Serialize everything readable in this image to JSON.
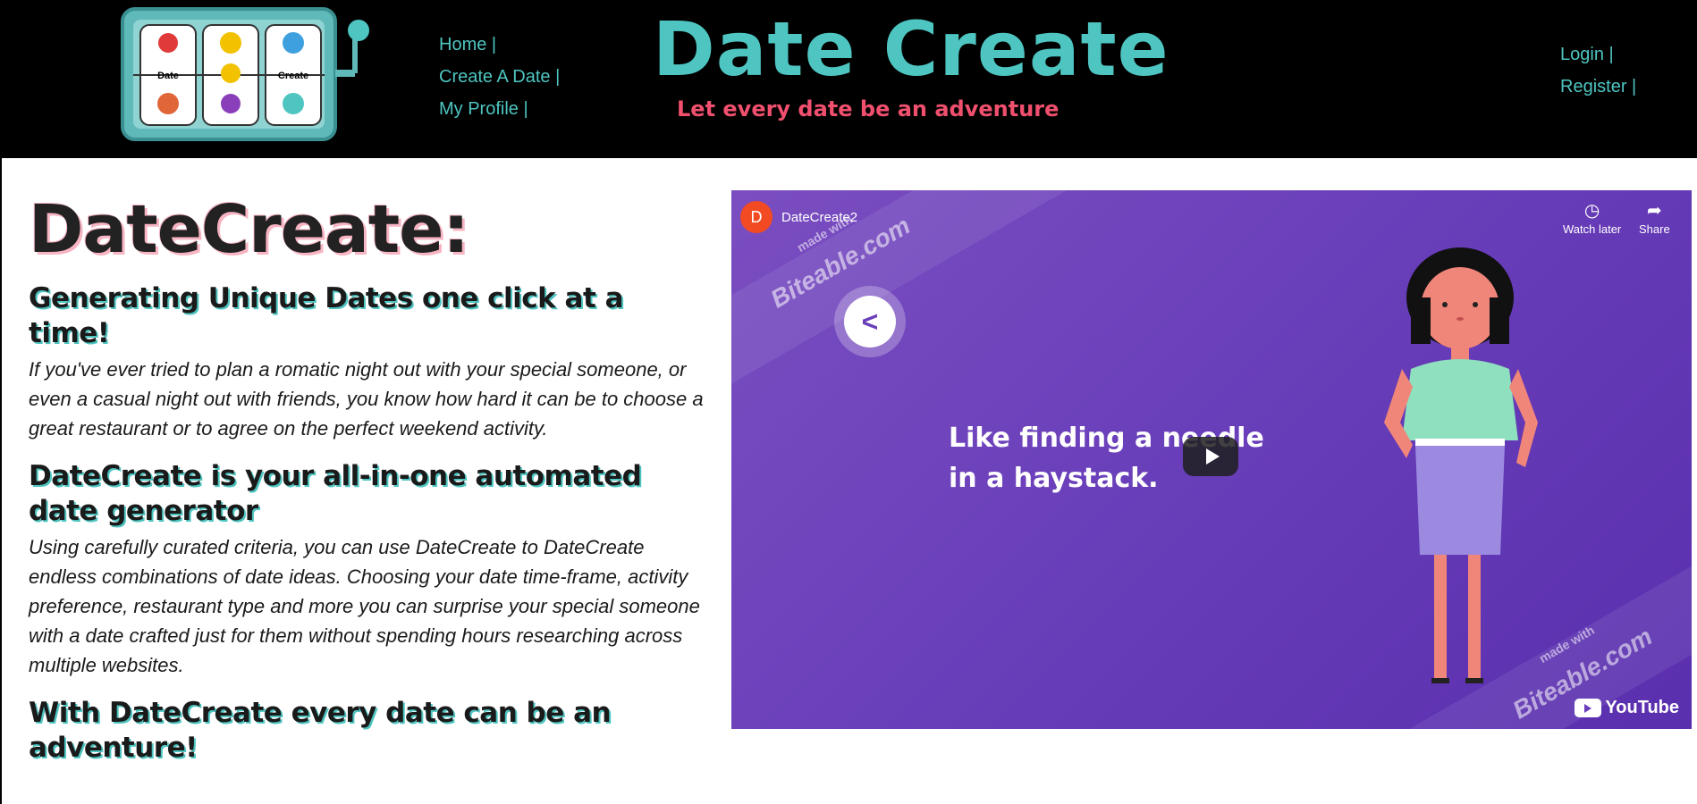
{
  "header": {
    "logo_labels": [
      "Date",
      "Create"
    ],
    "nav": [
      "Home |",
      "Create A Date |",
      "My Profile |"
    ],
    "site_title": "Date Create",
    "tagline": "Let every date be an adventure",
    "auth": [
      "Login |",
      "Register |"
    ]
  },
  "content": {
    "title": "DateCreate:",
    "heading1": "Generating Unique Dates one click at a time!",
    "paragraph1": "If you've ever tried to plan a romatic night out with your special someone, or even a casual night out with friends, you know how hard it can be to choose a great restaurant or to agree on the perfect weekend activity.",
    "heading2": "DateCreate is your all-in-one automated date generator",
    "paragraph2": "Using carefully curated criteria, you can use DateCreate to DateCreate endless combinations of date ideas. Choosing your date time-frame, activity preference, restaurant type and more you can surprise your special someone with a date crafted just for them without spending hours researching across multiple websites.",
    "heading3": "With DateCreate every date can be an adventure!"
  },
  "video": {
    "channel_initial": "D",
    "channel_name": "DateCreate2",
    "watch_later": "Watch later",
    "share": "Share",
    "stamp_small": "made with",
    "stamp_big": "Biteable.com",
    "back_symbol": "<",
    "caption": "Like finding a needle\nin a haystack.",
    "youtube": "YouTube"
  },
  "colors": {
    "accent": "#4ec5c1",
    "tagline": "#f0506e",
    "video_bg": "#6a3fba"
  }
}
